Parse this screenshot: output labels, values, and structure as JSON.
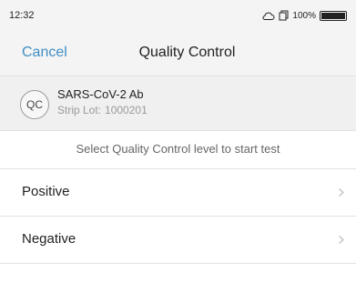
{
  "status_bar": {
    "time": "12:32",
    "icons": [
      "cloud-icon",
      "copy-icon",
      "battery-icon"
    ],
    "battery_level": 100,
    "battery_text": "100%"
  },
  "nav": {
    "cancel_label": "Cancel",
    "title": "Quality Control",
    "accent_color": "#3f8fc5"
  },
  "test": {
    "icon_text": "QC",
    "name": "SARS-CoV-2 Ab",
    "strip_lot_label": "Strip Lot:",
    "strip_lot_value": "1000201"
  },
  "instruction": "Select Quality Control level to start test",
  "levels": [
    {
      "label": "Positive",
      "icon": "chevron-right-icon"
    },
    {
      "label": "Negative",
      "icon": "chevron-right-icon"
    }
  ]
}
